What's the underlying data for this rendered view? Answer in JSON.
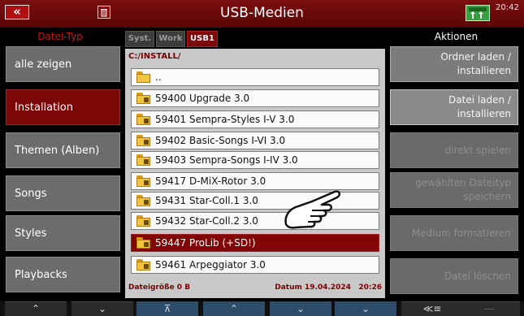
{
  "header": {
    "back_icon": "«",
    "title": "USB-Medien",
    "clock": "20:42"
  },
  "left": {
    "header": "Datei-Typ",
    "items": [
      {
        "label": "alle zeigen"
      },
      {
        "label": "Installation"
      },
      {
        "label": "Themen (Alben)"
      },
      {
        "label": "Songs"
      },
      {
        "label": "Styles"
      },
      {
        "label": "Playbacks"
      }
    ]
  },
  "tabs": [
    {
      "label": "Syst."
    },
    {
      "label": "Work"
    },
    {
      "label": "USB1"
    }
  ],
  "browser": {
    "path": "C:/INSTALL/",
    "rows": [
      {
        "label": ".."
      },
      {
        "label": "59400 Upgrade 3.0"
      },
      {
        "label": "59401 Sempra-Styles I-V 3.0"
      },
      {
        "label": "59402 Basic-Songs I-VI 3.0"
      },
      {
        "label": "59403 Sempra-Songs I-IV 3.0"
      },
      {
        "label": "59417 D-MiX-Rotor 3.0"
      },
      {
        "label": "59431 Star-Coll.1 3.0"
      },
      {
        "label": "59432 Star-Coll.2 3.0"
      },
      {
        "label": "59447 ProLib (+SD!)"
      },
      {
        "label": "59461 Arpeggiator 3.0"
      }
    ],
    "size_label": "Dateigröße 0 B",
    "date_label": "Datum 19.04.2024",
    "time_label": "20:26"
  },
  "right": {
    "header": "Aktionen",
    "items": [
      {
        "line1": "Ordner laden /",
        "line2": "installieren"
      },
      {
        "line1": "Datei laden /",
        "line2": "installieren"
      },
      {
        "line1": "direkt spielen",
        "line2": ""
      },
      {
        "line1": "gewählten Dateityp",
        "line2": "speichern"
      },
      {
        "line1": "Medium formatieren",
        "line2": ""
      },
      {
        "line1": "Datei löschen",
        "line2": ""
      }
    ]
  },
  "bottom": {
    "buttons": [
      {
        "label": "⌃"
      },
      {
        "label": "⌄"
      },
      {
        "label": "⊼"
      },
      {
        "label": "⌃"
      },
      {
        "label": "⌄"
      },
      {
        "label": "⌄"
      },
      {
        "label": "≪≡"
      },
      {
        "label": "---"
      }
    ]
  },
  "colors": {
    "accent": "#7b0707",
    "selected_row": "#820606"
  },
  "icons": {
    "back": "double-chevron-left-icon",
    "trash": "trash-icon",
    "usb": "usb-indicator-icon",
    "folder": "folder-icon",
    "cursor": "pointing-hand-icon"
  }
}
